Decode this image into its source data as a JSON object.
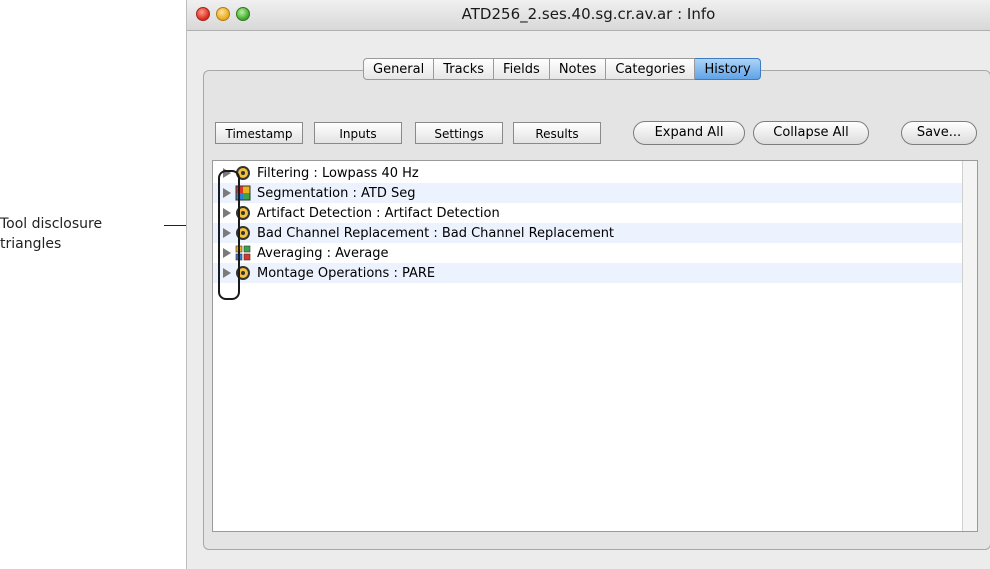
{
  "annotation": {
    "text": "Tool disclosure triangles"
  },
  "window": {
    "title": "ATD256_2.ses.40.sg.cr.av.ar : Info"
  },
  "tabs": [
    {
      "label": "General",
      "active": false
    },
    {
      "label": "Tracks",
      "active": false
    },
    {
      "label": "Fields",
      "active": false
    },
    {
      "label": "Notes",
      "active": false
    },
    {
      "label": "Categories",
      "active": false
    },
    {
      "label": "History",
      "active": true
    }
  ],
  "toolbar": {
    "timestamp": "Timestamp",
    "inputs": "Inputs",
    "settings": "Settings",
    "results": "Results",
    "expand_all": "Expand All",
    "collapse_all": "Collapse All",
    "save": "Save..."
  },
  "history": [
    {
      "label": "Filtering : Lowpass 40 Hz",
      "icon": "gear-icon"
    },
    {
      "label": "Segmentation : ATD Seg",
      "icon": "segmentation-icon"
    },
    {
      "label": "Artifact Detection : Artifact Detection",
      "icon": "gear-icon"
    },
    {
      "label": "Bad Channel Replacement : Bad Channel Replacement",
      "icon": "gear-icon"
    },
    {
      "label": "Averaging : Average",
      "icon": "averaging-icon"
    },
    {
      "label": "Montage Operations : PARE",
      "icon": "gear-icon"
    }
  ],
  "colors": {
    "active_tab": "#5fa3e8",
    "alt_row": "#edf3fe"
  }
}
